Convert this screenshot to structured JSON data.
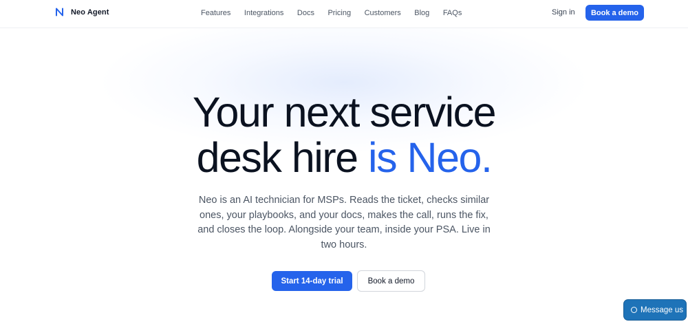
{
  "brand": {
    "name": "Neo Agent",
    "icon": "neo-logo-icon",
    "color": "#2563eb"
  },
  "nav": {
    "links": [
      "Features",
      "Integrations",
      "Docs",
      "Pricing",
      "Customers",
      "Blog",
      "FAQs"
    ],
    "sign_in": "Sign in",
    "book_demo": "Book a demo"
  },
  "hero": {
    "headline_line1": "Your next service",
    "headline_line2_plain": "desk hire ",
    "headline_line2_accent": "is Neo.",
    "subtext": "Neo is an AI technician for MSPs. Reads the ticket, checks similar ones, your playbooks, and your docs, makes the call, runs the fix, and closes the loop. Alongside your team, inside your PSA. Live in two hours.",
    "cta_primary": "Start 14-day trial",
    "cta_secondary": "Book a demo"
  },
  "chat_widget": {
    "label": "Message us",
    "icon": "chat-bubble-icon",
    "color": "#1e73b8"
  },
  "colors": {
    "accent": "#2563eb",
    "text": "#0b1220",
    "muted": "#4b5563"
  }
}
